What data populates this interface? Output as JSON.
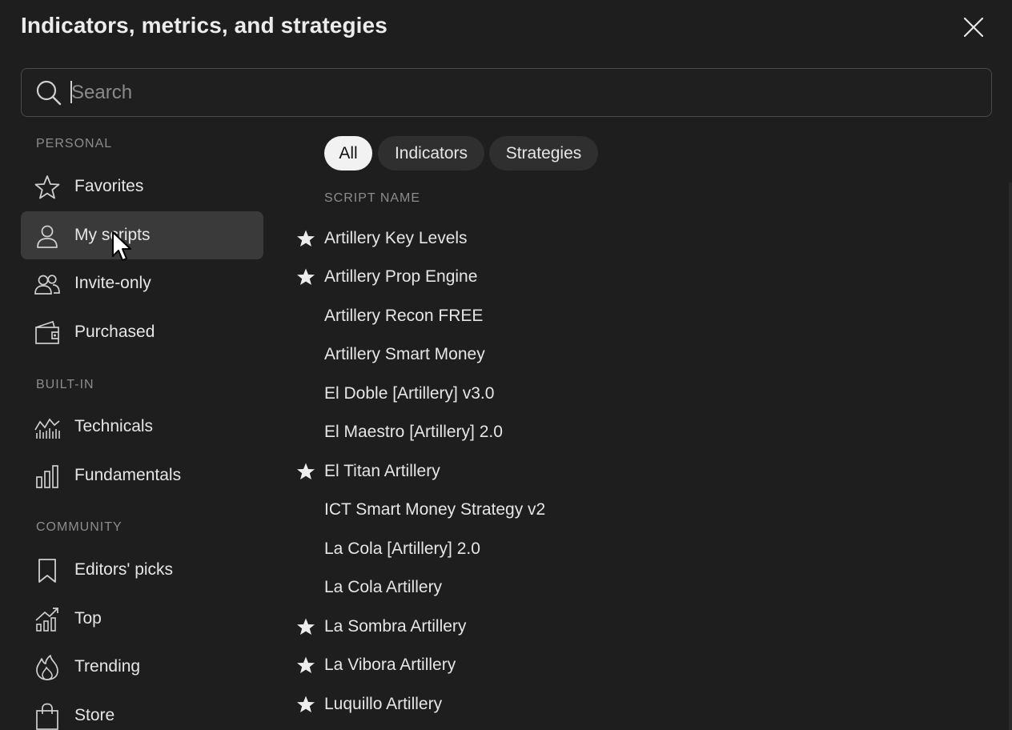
{
  "dialog": {
    "title": "Indicators, metrics, and strategies"
  },
  "search": {
    "placeholder": "Search",
    "value": ""
  },
  "sidebar": {
    "sections": [
      {
        "header": "PERSONAL",
        "items": [
          {
            "label": "Favorites",
            "icon": "star-outline-icon"
          },
          {
            "label": "My scripts",
            "icon": "user-icon",
            "active": true
          },
          {
            "label": "Invite-only",
            "icon": "users-icon"
          },
          {
            "label": "Purchased",
            "icon": "wallet-icon"
          }
        ]
      },
      {
        "header": "BUILT-IN",
        "items": [
          {
            "label": "Technicals",
            "icon": "chart-line-icon"
          },
          {
            "label": "Fundamentals",
            "icon": "bar-chart-icon"
          }
        ]
      },
      {
        "header": "COMMUNITY",
        "items": [
          {
            "label": "Editors' picks",
            "icon": "bookmark-icon"
          },
          {
            "label": "Top",
            "icon": "growth-chart-icon"
          },
          {
            "label": "Trending",
            "icon": "flame-icon"
          },
          {
            "label": "Store",
            "icon": "shopping-bag-icon"
          }
        ]
      }
    ]
  },
  "filters": {
    "chips": [
      {
        "label": "All",
        "selected": true
      },
      {
        "label": "Indicators",
        "selected": false
      },
      {
        "label": "Strategies",
        "selected": false
      }
    ]
  },
  "scripts": {
    "column_header": "SCRIPT NAME",
    "rows": [
      {
        "name": "Artillery Key Levels",
        "favorite": true
      },
      {
        "name": "Artillery Prop Engine",
        "favorite": true
      },
      {
        "name": "Artillery Recon FREE",
        "favorite": false
      },
      {
        "name": "Artillery Smart Money",
        "favorite": false
      },
      {
        "name": "El Doble [Artillery] v3.0",
        "favorite": false
      },
      {
        "name": "El Maestro [Artillery] 2.0",
        "favorite": false
      },
      {
        "name": "El Titan Artillery",
        "favorite": true
      },
      {
        "name": "ICT Smart Money Strategy v2",
        "favorite": false
      },
      {
        "name": "La Cola [Artillery] 2.0",
        "favorite": false
      },
      {
        "name": "La Cola Artillery",
        "favorite": false
      },
      {
        "name": "La Sombra Artillery",
        "favorite": true
      },
      {
        "name": "La Vibora Artillery",
        "favorite": true
      },
      {
        "name": "Luquillo Artillery",
        "favorite": true
      }
    ]
  },
  "colors": {
    "background": "#1e1e1e",
    "active_item": "#3a3a3a",
    "chip": "#2f2f2f",
    "chip_selected": "#f2f2f2",
    "muted_text": "#8c8c8c"
  }
}
